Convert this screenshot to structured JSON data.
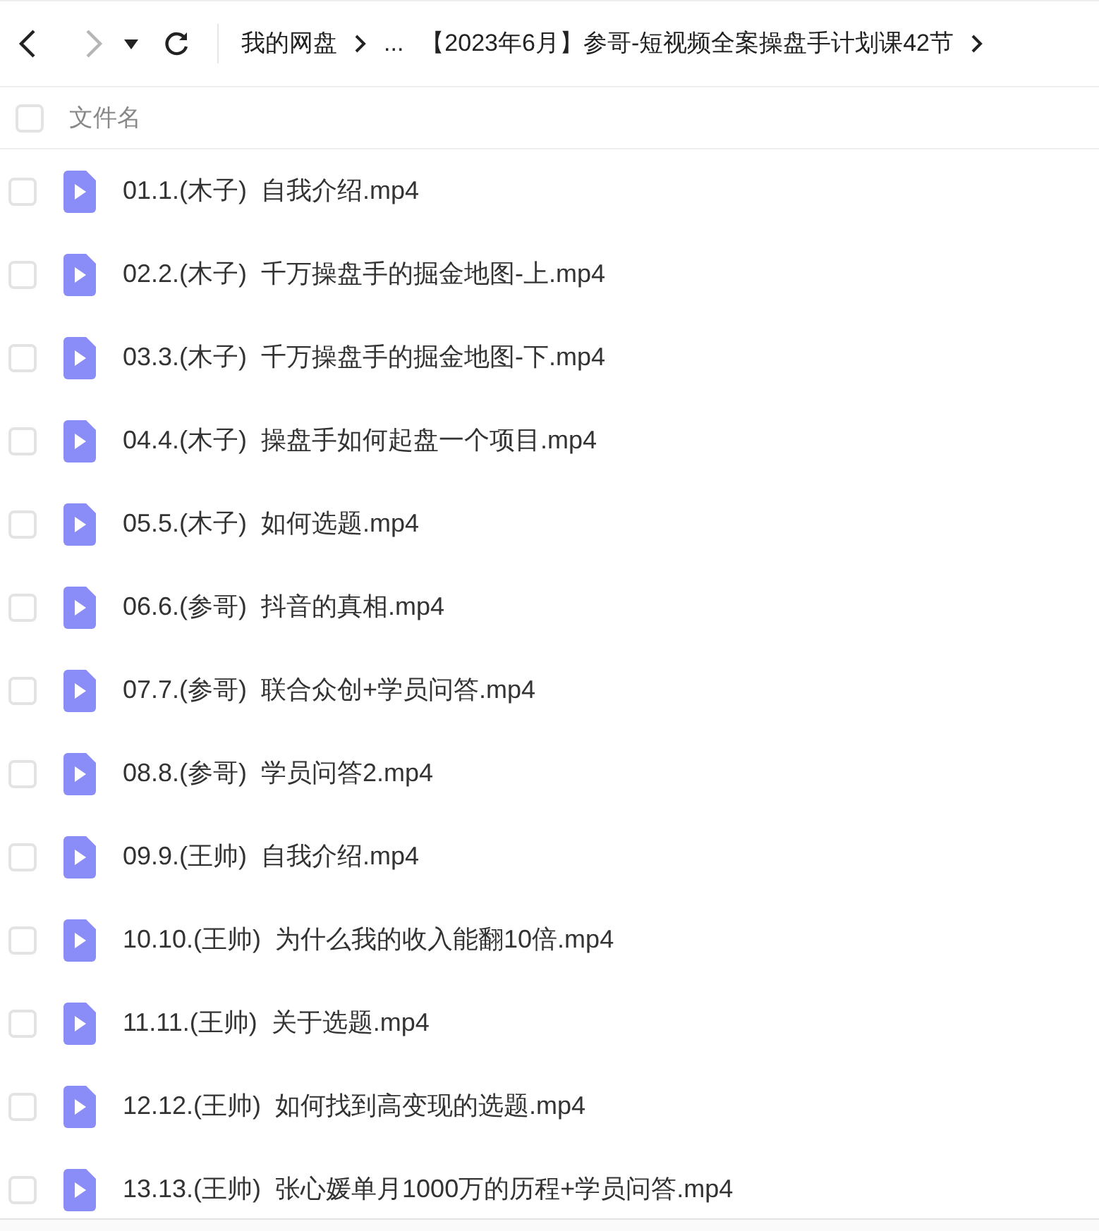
{
  "toolbar": {
    "back": {
      "disabled": false
    },
    "forward": {
      "disabled": true
    },
    "breadcrumb": [
      {
        "label": "我的网盘"
      },
      {
        "label": "..."
      },
      {
        "label": "【2023年6月】参哥-短视频全案操盘手计划课42节"
      }
    ]
  },
  "header": {
    "checked": false,
    "label": "文件名"
  },
  "files": [
    {
      "name": "01.1.(木子)  自我介绍.mp4",
      "checked": false
    },
    {
      "name": "02.2.(木子)  千万操盘手的掘金地图-上.mp4",
      "checked": false
    },
    {
      "name": "03.3.(木子)  千万操盘手的掘金地图-下.mp4",
      "checked": false
    },
    {
      "name": "04.4.(木子)  操盘手如何起盘一个项目.mp4",
      "checked": false
    },
    {
      "name": "05.5.(木子)  如何选题.mp4",
      "checked": false
    },
    {
      "name": "06.6.(参哥)  抖音的真相.mp4",
      "checked": false
    },
    {
      "name": "07.7.(参哥)  联合众创+学员问答.mp4",
      "checked": false
    },
    {
      "name": "08.8.(参哥)  学员问答2.mp4",
      "checked": false
    },
    {
      "name": "09.9.(王帅)  自我介绍.mp4",
      "checked": false
    },
    {
      "name": "10.10.(王帅)  为什么我的收入能翻10倍.mp4",
      "checked": false
    },
    {
      "name": "11.11.(王帅)  关于选题.mp4",
      "checked": false
    },
    {
      "name": "12.12.(王帅)  如何找到高变现的选题.mp4",
      "checked": false
    },
    {
      "name": "13.13.(王帅)  张心媛单月1000万的历程+学员问答.mp4",
      "checked": false
    }
  ]
}
